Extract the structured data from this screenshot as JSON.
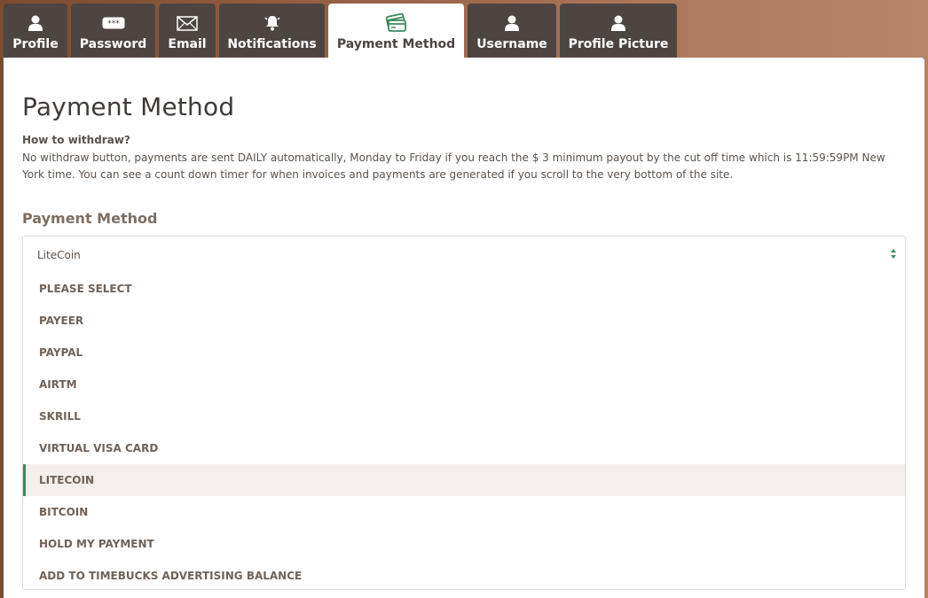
{
  "tabs": [
    {
      "label": "Profile",
      "icon": "user-icon"
    },
    {
      "label": "Password",
      "icon": "password-icon"
    },
    {
      "label": "Email",
      "icon": "envelope-icon"
    },
    {
      "label": "Notifications",
      "icon": "bell-icon"
    },
    {
      "label": "Payment Method",
      "icon": "payment-cards-icon",
      "active": true
    },
    {
      "label": "Username",
      "icon": "user-icon"
    },
    {
      "label": "Profile Picture",
      "icon": "user-icon"
    }
  ],
  "page": {
    "title": "Payment Method",
    "withdraw_question": "How to withdraw?",
    "withdraw_text": "No withdraw button, payments are sent DAILY automatically, Monday to Friday if you reach the $ 3 minimum payout by the cut off time which is 11:59:59PM New York time. You can see a count down timer for when invoices and payments are generated if you scroll to the very bottom of the site."
  },
  "payment_field": {
    "label": "Payment Method",
    "current_value": "LiteCoin",
    "options": [
      "PLEASE SELECT",
      "PAYEER",
      "PAYPAL",
      "AIRTM",
      "SKRILL",
      "VIRTUAL VISA CARD",
      "LITECOIN",
      "BITCOIN",
      "HOLD MY PAYMENT",
      "ADD TO TIMEBUCKS ADVERTISING BALANCE"
    ],
    "selected_index": 6
  },
  "colors": {
    "tab_bg": "#4d4542",
    "accent_green": "#3b8a5e",
    "text_brown": "#7d6e63"
  }
}
